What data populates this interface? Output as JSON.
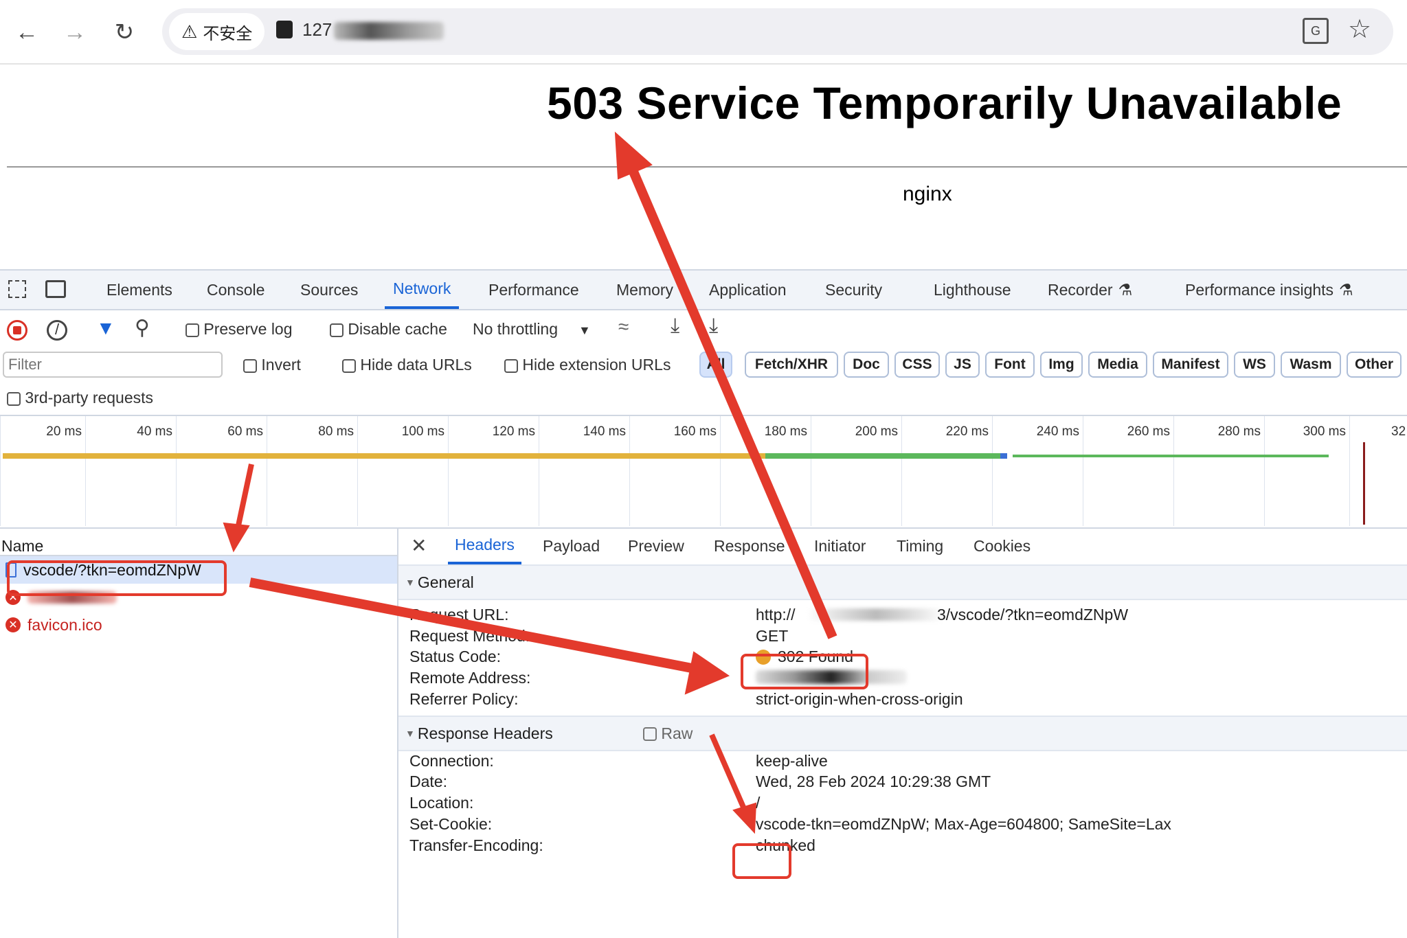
{
  "browser": {
    "security_label": "不安全",
    "url_visible": "127"
  },
  "page": {
    "heading": "503 Service Temporarily Unavailable",
    "server": "nginx"
  },
  "devtools": {
    "tabs": [
      "Elements",
      "Console",
      "Sources",
      "Network",
      "Performance",
      "Memory",
      "Application",
      "Security",
      "Lighthouse",
      "Recorder",
      "Performance insights"
    ],
    "active_tab": "Network",
    "toolbar": {
      "preserve_log": "Preserve log",
      "disable_cache": "Disable cache",
      "throttling": "No throttling"
    },
    "filter": {
      "placeholder": "Filter",
      "invert": "Invert",
      "hide_data_urls": "Hide data URLs",
      "hide_extension_urls": "Hide extension URLs",
      "types": [
        "All",
        "Fetch/XHR",
        "Doc",
        "CSS",
        "JS",
        "Font",
        "Img",
        "Media",
        "Manifest",
        "WS",
        "Wasm",
        "Other"
      ],
      "third_party": "3rd-party requests"
    },
    "timeline_ticks": [
      "20 ms",
      "40 ms",
      "60 ms",
      "80 ms",
      "100 ms",
      "120 ms",
      "140 ms",
      "160 ms",
      "180 ms",
      "200 ms",
      "220 ms",
      "240 ms",
      "260 ms",
      "280 ms",
      "300 ms",
      "32"
    ],
    "requests": {
      "header": "Name",
      "rows": [
        {
          "name": "vscode/?tkn=eomdZNpW",
          "status": "ok"
        },
        {
          "name": "",
          "status": "error"
        },
        {
          "name": "favicon.ico",
          "status": "error"
        }
      ]
    },
    "detail": {
      "tabs": [
        "Headers",
        "Payload",
        "Preview",
        "Response",
        "Initiator",
        "Timing",
        "Cookies"
      ],
      "active_tab": "Headers",
      "general_title": "General",
      "general": [
        {
          "k": "Request URL:",
          "v": "http://"
        },
        {
          "k": "Request Method:",
          "v": "GET"
        },
        {
          "k": "Status Code:",
          "v": "302 Found"
        },
        {
          "k": "Remote Address:",
          "v": ""
        },
        {
          "k": "Referrer Policy:",
          "v": "strict-origin-when-cross-origin"
        }
      ],
      "request_url_tail": "3/vscode/?tkn=eomdZNpW",
      "response_title": "Response Headers",
      "raw_label": "Raw",
      "response": [
        {
          "k": "Connection:",
          "v": "keep-alive"
        },
        {
          "k": "Date:",
          "v": "Wed, 28 Feb 2024 10:29:38 GMT"
        },
        {
          "k": "Location:",
          "v": "/"
        },
        {
          "k": "Set-Cookie:",
          "v": "vscode-tkn=eomdZNpW; Max-Age=604800; SameSite=Lax"
        },
        {
          "k": "Transfer-Encoding:",
          "v": "chunked"
        }
      ]
    }
  },
  "colors": {
    "accent": "#1a64d6",
    "annotation": "#e33a2c",
    "status_302": "#e8a02a",
    "error": "#d93025"
  }
}
